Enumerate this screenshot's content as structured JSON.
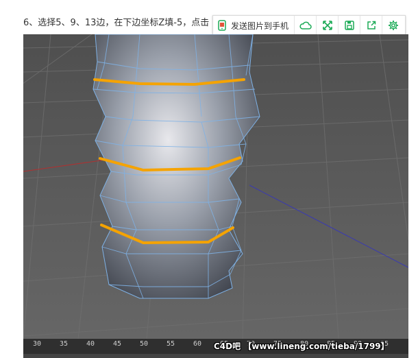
{
  "caption": "6、选择5、9、13边，在下边坐标Z填-5，点击",
  "toolbar": {
    "send_label": "发送图片到手机",
    "icons": [
      "phone-send-icon",
      "cloud-icon",
      "fullscreen-icon",
      "save-icon",
      "share-icon",
      "settings-icon"
    ]
  },
  "viewport": {
    "ruler_labels": [
      "30",
      "35",
      "40",
      "45",
      "50",
      "55",
      "60",
      "65",
      "70",
      "75",
      "80",
      "85",
      "90",
      "95"
    ],
    "watermark": "C4D吧 【www.lineng.com/tieba/1799】"
  },
  "colors": {
    "accent_green": "#1aaa55",
    "edge_orange": "#f5a300",
    "wire_blue": "#7fb2e6"
  }
}
